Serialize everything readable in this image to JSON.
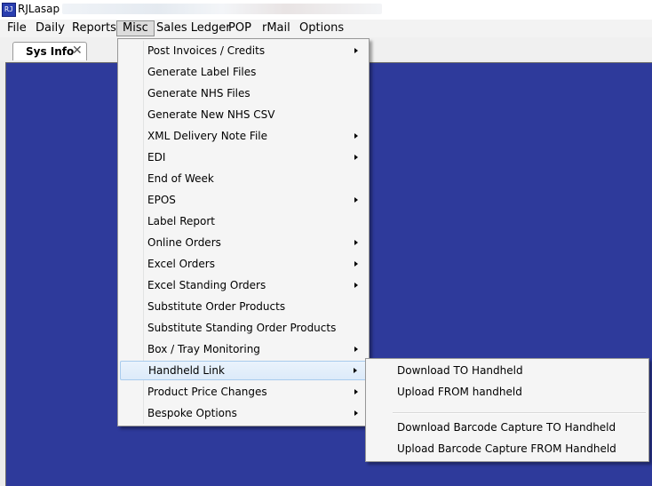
{
  "window": {
    "title": "RJLasap",
    "app_icon_text": "RJ"
  },
  "menubar": {
    "items": [
      "File",
      "Daily",
      "Reports",
      "Misc",
      "Sales Ledger",
      "POP",
      "rMail",
      "Options"
    ],
    "active": "Misc"
  },
  "tabs": [
    {
      "label": "Sys Info",
      "close": "✕"
    }
  ],
  "misc_menu": {
    "items": [
      {
        "label": "Post Invoices / Credits",
        "submenu": true
      },
      {
        "label": "Generate Label Files",
        "submenu": false
      },
      {
        "label": "Generate NHS Files",
        "submenu": false
      },
      {
        "label": "Generate New NHS CSV",
        "submenu": false
      },
      {
        "label": "XML Delivery Note File",
        "submenu": true
      },
      {
        "label": "EDI",
        "submenu": true
      },
      {
        "label": "End of Week",
        "submenu": false
      },
      {
        "label": "EPOS",
        "submenu": true
      },
      {
        "label": "Label Report",
        "submenu": false
      },
      {
        "label": "Online Orders",
        "submenu": true
      },
      {
        "label": "Excel Orders",
        "submenu": true
      },
      {
        "label": "Excel Standing Orders",
        "submenu": true
      },
      {
        "label": "Substitute Order Products",
        "submenu": false
      },
      {
        "label": "Substitute Standing Order Products",
        "submenu": false
      },
      {
        "label": "Box / Tray Monitoring",
        "submenu": true
      },
      {
        "label": "Handheld Link",
        "submenu": true,
        "highlighted": true
      },
      {
        "label": "Product Price Changes",
        "submenu": true
      },
      {
        "label": "Bespoke Options",
        "submenu": true
      }
    ]
  },
  "handheld_submenu": {
    "items": [
      "Download TO Handheld",
      "Upload FROM handheld",
      "Download Barcode Capture TO Handheld",
      "Upload Barcode Capture FROM Handheld"
    ]
  },
  "colors": {
    "content_background": "#2e3a9b",
    "menu_highlight": "#dceaf9"
  }
}
